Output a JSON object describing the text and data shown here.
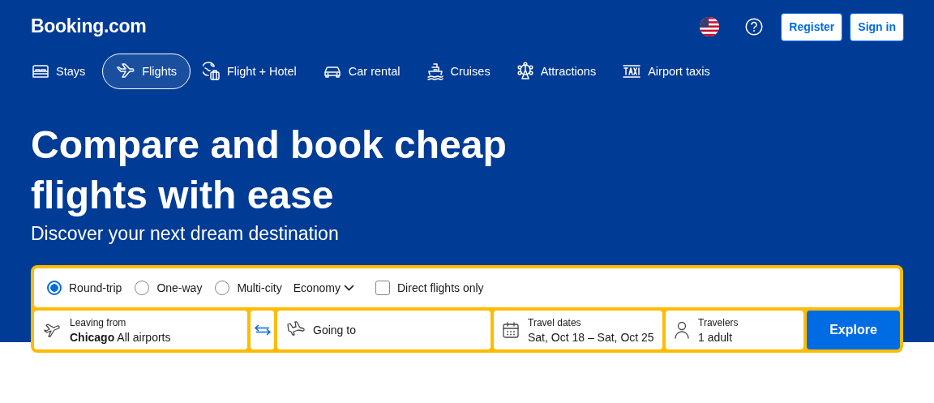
{
  "header": {
    "logo": "Booking.com",
    "buttons": [
      "Register",
      "Sign in"
    ]
  },
  "nav": [
    {
      "label": "Stays",
      "selected": false
    },
    {
      "label": "Flights",
      "selected": true
    },
    {
      "label": "Flight + Hotel",
      "selected": false
    },
    {
      "label": "Car rental",
      "selected": false
    },
    {
      "label": "Cruises",
      "selected": false
    },
    {
      "label": "Attractions",
      "selected": false
    },
    {
      "label": "Airport taxis",
      "selected": false
    }
  ],
  "hero": {
    "title": "Compare and book cheap flights with ease",
    "subtitle": "Discover your next dream destination"
  },
  "search": {
    "trip_types": [
      {
        "label": "Round-trip",
        "selected": true
      },
      {
        "label": "One-way",
        "selected": false
      },
      {
        "label": "Multi-city",
        "selected": false
      }
    ],
    "cabin": "Economy",
    "direct_only": {
      "label": "Direct flights only",
      "checked": false
    },
    "leaving": {
      "label": "Leaving from",
      "value": "**Chicago** All airports"
    },
    "going": {
      "placeholder": "Going to"
    },
    "dates": {
      "label": "Travel dates",
      "value": "Sat, Oct 18 – Sat, Oct 25"
    },
    "travelers": {
      "label": "Travelers",
      "value": "1 adult"
    },
    "submit": "Explore"
  }
}
